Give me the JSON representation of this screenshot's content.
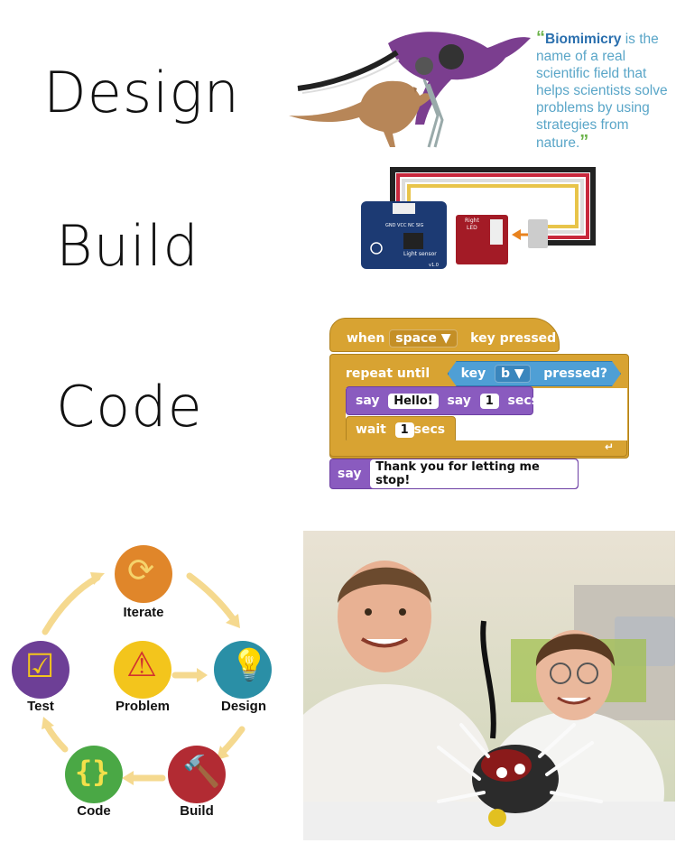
{
  "sections": {
    "design": "Design",
    "build": "Build",
    "code": "Code"
  },
  "quote": {
    "highlight": "Biomimicry",
    "rest": " is the name of a real scientific field that helps scientists solve problems by using strategies from nature."
  },
  "circuit": {
    "sensor_label": "Light sensor",
    "sensor_pins": "GND VCC NC SIG",
    "sensor_version": "v1.0",
    "led_label_1": "Right",
    "led_label_2": "LED"
  },
  "scratch": {
    "when": "when",
    "key_value": "space",
    "key_pressed": "key  pressed",
    "repeat_until": "repeat until",
    "key": "key",
    "key_b": "b",
    "pressed_q": "pressed?",
    "say": "say",
    "hello": "Hello!",
    "say2": "say",
    "num1": "1",
    "secs": "secs",
    "wait": "wait",
    "num2": "1",
    "secs2": "secs",
    "say_final": "say",
    "thank_you": "Thank you for letting me stop!"
  },
  "cycle": {
    "iterate": "Iterate",
    "problem": "Problem",
    "design": "Design",
    "test": "Test",
    "build": "Build",
    "code": "Code",
    "colors": {
      "iterate": "#e0862a",
      "problem": "#f3c51c",
      "design": "#2a8fa6",
      "test": "#6d3f96",
      "build": "#b22b33",
      "code": "#4aa845",
      "arrow": "#f5d98f"
    }
  }
}
